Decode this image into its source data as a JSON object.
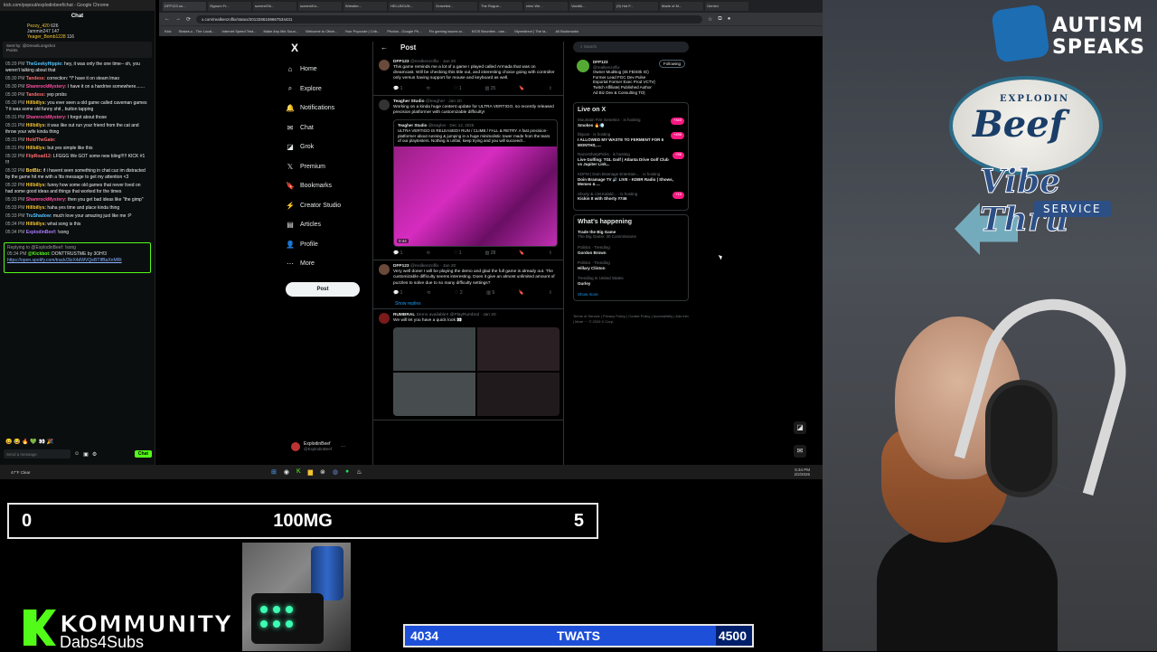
{
  "chat": {
    "window_title": "kick.com/popout/explodinbeef/chat - Google Chrome",
    "header": "Chat",
    "leaderboard": [
      {
        "name": "Pezzy_420",
        "value": "626"
      },
      {
        "name": "Jammin247",
        "value": "147"
      },
      {
        "name": "Yeager_Bomb1228",
        "value": "116"
      }
    ],
    "pinned_by": "Sent by: @DrexelLongshot",
    "pinned_text": "Points",
    "messages": [
      {
        "time": "05:29 PM",
        "user": "TheGeekyHippie:",
        "text": "hey, it was only the one time-- oh, you weren't talking about that"
      },
      {
        "time": "05:30 PM",
        "user": "Tandess:",
        "text": "correction: *I* have it on steam lmao"
      },
      {
        "time": "05:30 PM",
        "user": "ShamrockMystery:",
        "text": "I have it on a hardrive somewhere......."
      },
      {
        "time": "05:30 PM",
        "user": "Tandess:",
        "text": "yep probs"
      },
      {
        "time": "05:30 PM",
        "user": "Hillbillys:",
        "text": "you ever seen a old game called caveman games ? it was some old funny shit , button tapping"
      },
      {
        "time": "05:31 PM",
        "user": "ShamrockMystery:",
        "text": "I forgot about those"
      },
      {
        "time": "05:31 PM",
        "user": "Hillbillys:",
        "text": "it was like out run your friend from the cat and throw your wife kinda thing"
      },
      {
        "time": "05:31 PM",
        "user": "HoldTheGate:",
        "text": ""
      },
      {
        "time": "05:31 PM",
        "user": "Hillbillys:",
        "text": "but yes simple like this"
      },
      {
        "time": "05:32 PM",
        "user": "FlipRoad12:",
        "text": "LFGGG We GOT some new bling!!!!! KICK #1 !!!"
      },
      {
        "time": "05:32 PM",
        "user": "BotBiz:",
        "text": "if i havent seen something in chat cuz im distracted by the game hit me with a !tts message to get my attention <3"
      },
      {
        "time": "05:32 PM",
        "user": "Hillbillys:",
        "text": "funny how some old games that never lived on had some good ideas and things that worked for the times"
      },
      {
        "time": "05:33 PM",
        "user": "ShamrockMystery:",
        "text": "then you get bad ideas like \"the gimp\""
      },
      {
        "time": "05:33 PM",
        "user": "Hillbillys:",
        "text": "haha yes time and place kinda thing"
      },
      {
        "time": "05:33 PM",
        "user": "TruShadow:",
        "text": "much love your amazing just like me :P"
      },
      {
        "time": "05:34 PM",
        "user": "Hillbillys:",
        "text": "what song is this"
      },
      {
        "time": "05:34 PM",
        "user": "ExplodinBeef:",
        "text": "!song"
      }
    ],
    "reply_to": "Replying to @ExplodinBeef: !song",
    "reply_time": "05:34 PM",
    "reply_user": "@Kickbot:",
    "reply_text": "DONTTRUSTME by 3OH!3",
    "reply_link": "https://open.spotify.com/track/3lzX4dWVQeBTtfBaXnMRt",
    "input_placeholder": "Send a message",
    "chat_button": "Chat"
  },
  "browser": {
    "tabs": [
      "DFP123 on...",
      "Signum Fr...",
      "screen/Sh...",
      "screen/Kn...",
      "Wrestler...",
      "HELLBOUN...",
      "Graveled...",
      "The Rogue...",
      "retro We...",
      "Vanill&...",
      "(9) Hot F...",
      "Made of M...",
      "Gemini"
    ],
    "url": "x.com/realkenzoflix/status/2013286159667534431",
    "bookmarks": [
      "Kick",
      "Stakes.u - The Local...",
      "Internet Speed Test...",
      "Make Any Mix Soun...",
      "Welcome to Ottoh...",
      "Your Popcode | Crib...",
      "Photos - Google Ph...",
      "Fix gaming issues w...",
      "KIOS Bounties - use...",
      "Mynedirect | The la...",
      "All Bookmarks"
    ]
  },
  "x": {
    "logo": "X",
    "nav": [
      {
        "icon": "⌂",
        "label": "Home"
      },
      {
        "icon": "⌕",
        "label": "Explore"
      },
      {
        "icon": "🔔",
        "label": "Notifications"
      },
      {
        "icon": "✉",
        "label": "Chat"
      },
      {
        "icon": "◪",
        "label": "Grok"
      },
      {
        "icon": "𝕏",
        "label": "Premium"
      },
      {
        "icon": "🔖",
        "label": "Bookmarks"
      },
      {
        "icon": "⚡",
        "label": "Creator Studio"
      },
      {
        "icon": "▤",
        "label": "Articles"
      },
      {
        "icon": "👤",
        "label": "Profile"
      },
      {
        "icon": "⋯",
        "label": "More"
      }
    ],
    "post_button": "Post",
    "account": {
      "name": "ExplodinBeef",
      "handle": "@ExplodinBeef"
    },
    "timeline_title": "Post",
    "tweets": [
      {
        "name": "DFP123",
        "meta": "@realkenzoflix · Jan 20",
        "text": "This game reminds me a lot of a game I played called Armada that was on dreamcast. Will be checking this title out, and interesting choice going with controller only versus having support for mouse and keyboard as well.",
        "replies": "1",
        "reposts": "",
        "likes": "1",
        "views": "25"
      },
      {
        "name": "Teagher Studio",
        "meta": "@teagher · Jan 20",
        "text": "Working on a kinda huge content update for ULTRA VERTIGO, so recently released precision platformer with customizable difficulty!",
        "quote_name": "Teagher Studio",
        "quote_meta": "@teagher · Dec 12, 2025",
        "quote_text": "ULTRA VERTIGO IS RELEASED!! RUN / CLIMB / FALL & RETRY. A fast precision-platformer about running & jumping in a huge minimalistic tower made from the tears of our playtesters. Nothing is unfair, keep trying and you will succeed!...",
        "video_time": "0:44",
        "replies": "1",
        "reposts": "",
        "likes": "1",
        "views": "28"
      },
      {
        "name": "DFP123",
        "meta": "@realkenzoflix · Jan 20",
        "text": "Very well done! I will be playing the demo and glad the full game is already out. The customizable difficulty seems interesting. Does it give an almost unlimited amount of puzzles to solve due to so many difficulty settings?",
        "replies": "1",
        "reposts": "",
        "likes": "2",
        "views": "9"
      }
    ],
    "show_replies": "Show replies",
    "promo": {
      "name": "RUMBRAL",
      "meta": "Demo available!! @PlayRumbral · Jan 20",
      "text": "We will let you have a quick look 👀"
    },
    "search_placeholder": "Search",
    "profile": {
      "name": "DFP123",
      "handle": "@realkenzoflix",
      "follow_label": "Following",
      "bio": "Owner MudBog (4k FB/40k IG) Former Lead FGC Dev Pulse Esportal Former Exec Prod VCTV| Twitch Affiliate| Published Author Ad Biz Dev & Consulting TO|"
    },
    "live_title": "Live on X",
    "live": [
      {
        "host": "Mountain Fire Genetics · is hosting",
        "title": "Smokes 🔥💨",
        "count": "+343"
      },
      {
        "host": "bbjoos · is hosting",
        "title": "I ALLOWED MY WASTE TO FERMENT FOR 6 MONTHS, ...",
        "count": "+496"
      },
      {
        "host": "RazorSharpPicks · is hosting",
        "title": "Live Golfing: TGL Golf | Atlanta Drive Golf Club vs Jupiter Link...",
        "count": "+56"
      },
      {
        "host": "KDFM | Doin Bramage Entertain... · is hosting",
        "title": "Doin Bramage TV 🔊 LIVE - KDBR Radio | Shows, Memes & ...",
        "count": ""
      },
      {
        "host": "Shorty & J.M.Kalald... · is hosting",
        "title": "Kickin It with Shorty #746",
        "count": "+10"
      }
    ],
    "happening_title": "What's happening",
    "trends": [
      {
        "cat": "",
        "name": "Trade the Big Game",
        "sub": "The Big Game: 30 Commissions"
      },
      {
        "cat": "Politics · Trending",
        "name": "Gordon Brown",
        "sub": ""
      },
      {
        "cat": "Politics · Trending",
        "name": "Hillary Clinton",
        "sub": ""
      },
      {
        "cat": "Trending in United States",
        "name": "Gurley",
        "sub": ""
      }
    ],
    "show_more": "Show more",
    "footer": "Terms of Service | Privacy Policy | Cookie Policy | Accessibility | Ads info | More ··· © 2026 X Corp."
  },
  "taskbar": {
    "weather": "47°F Clear",
    "time": "5:34 PM",
    "date": "2/2/2026"
  },
  "overlays": {
    "autism_line1": "AUTISM",
    "autism_line2": "SPEAKS",
    "beef_top": "EXPLODIN",
    "beef_main": "Beef",
    "vibe": "Vibe Thru",
    "service": "SERVICE",
    "counter_left": "0",
    "counter_center": "100MG",
    "counter_right": "5",
    "kommunity": "KOMMUNITY",
    "kommunity_sub": "Dabs4Subs",
    "goal_current": "4034",
    "goal_label": "TWATS",
    "goal_target": "4500",
    "goal_fraction": 0.8964
  }
}
